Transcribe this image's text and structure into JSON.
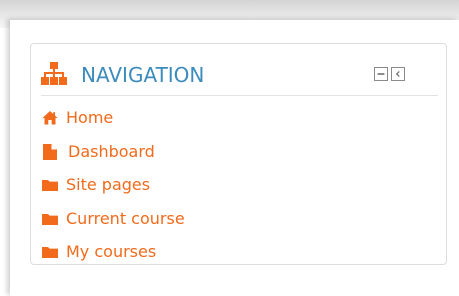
{
  "block": {
    "title": "NAVIGATION",
    "title_color": "#3b8bbd",
    "header_icon": "sitemap-icon",
    "controls": {
      "hide": "minus-box-icon",
      "dock": "dock-left-icon"
    }
  },
  "nav": {
    "link_color": "#f26a1b",
    "items": [
      {
        "label": "Home",
        "icon": "home-icon"
      },
      {
        "label": "Dashboard",
        "icon": "document-icon"
      },
      {
        "label": "Site pages",
        "icon": "folder-icon"
      },
      {
        "label": "Current course",
        "icon": "folder-icon"
      },
      {
        "label": "My courses",
        "icon": "folder-icon"
      }
    ]
  }
}
